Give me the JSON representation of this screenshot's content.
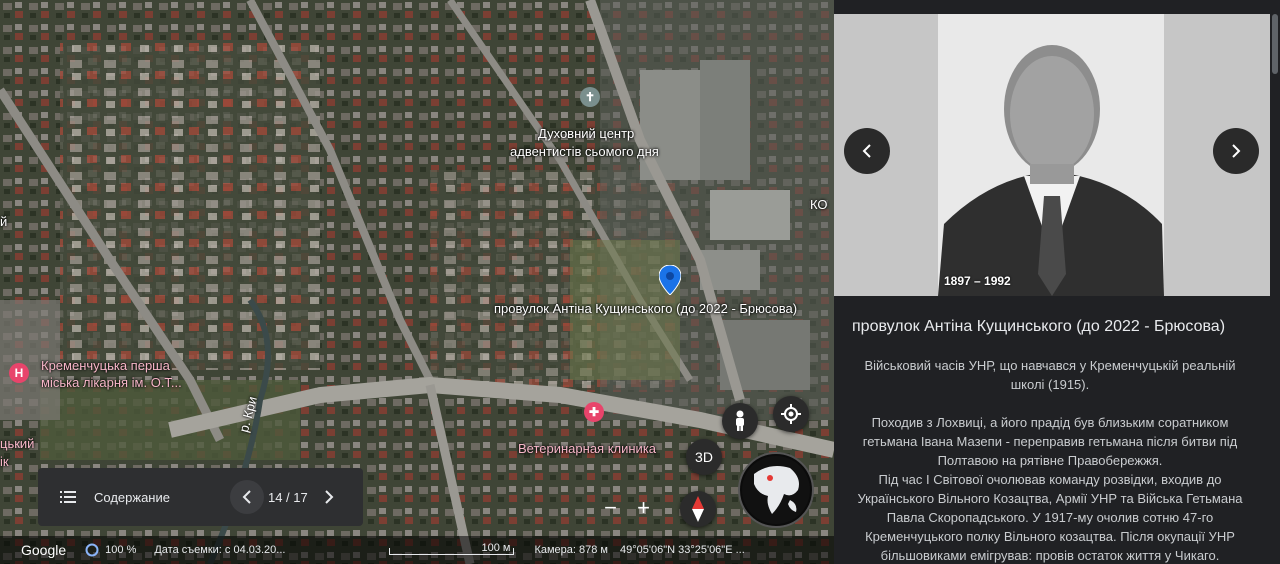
{
  "map": {
    "labels": {
      "adventist_center_line1": "Духовний центр",
      "adventist_center_line2": "адвентистів сьомого дня",
      "street_pin": "провулок Антіна Кущинського (до 2022 - Брюсова)",
      "hospital_line1": "Кременчуцька перша",
      "hospital_line2": "міська лікарня ім. О.Т...",
      "vet_clinic": "Ветеринарная клиника",
      "river": "р. Кри",
      "left_edge_line1": "цький",
      "left_edge_line2": "ік",
      "right_edge": "КО",
      "left_top_edge": "й"
    },
    "buttons": {
      "three_d": "3D",
      "zoom_out": "−",
      "zoom_in": "+"
    },
    "icons": {
      "pin": "location-pin-icon",
      "pegman": "pegman-icon",
      "locate": "my-location-icon",
      "compass": "compass-icon",
      "globe": "globe-icon",
      "church": "church-icon",
      "hospital": "hospital-icon",
      "vet": "vet-clinic-icon"
    }
  },
  "toc": {
    "label": "Содержание",
    "counter": "14 / 17"
  },
  "statusbar": {
    "brand": "Google",
    "loading": "100 %",
    "capture_date": "Дата съемки: с 04.03.20...",
    "scale": "100 м",
    "camera": "Камера: 878 м",
    "coords": "49°05'06\"N 33°25'06\"E ..."
  },
  "panel": {
    "photo_years": "1897 – 1992",
    "title": "провулок Антіна Кущинського (до 2022 - Брюсова)",
    "paragraphs": [
      "Військовий часів УНР,  що навчався у Кременчуцькій реальній школі (1915).",
      "Походив з Лохвиці, а його прадід був близьким соратником гетьмана Івана Мазепи -  переправив гетьмана після битви під Полтавою на рятівне Правобережжя.",
      "Під час І Світової  очолював команду розвідки, входив до Українського Вільного Козацтва, Армії УНР та Війська Гетьмана Павла Скоропадського. У 1917-му очолив сотню 47-го Кременчуцького полку Вільного козацтва. Після окупації УНР більшовиками емігрував: провів остаток життя у Чикаго."
    ]
  },
  "colors": {
    "panel_bg": "#202124",
    "pin_blue": "#1a73e8",
    "poi_pink": "#e8446b"
  }
}
